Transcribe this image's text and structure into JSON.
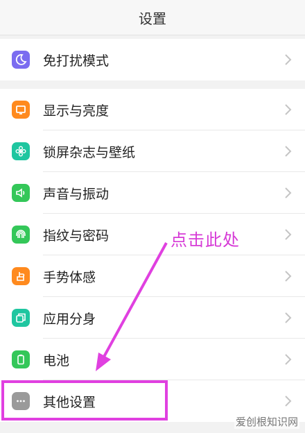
{
  "header": {
    "title": "设置"
  },
  "group1": [
    {
      "label": "免打扰模式",
      "icon": "moon-icon",
      "color": "#7b6cf0"
    }
  ],
  "group2": [
    {
      "label": "显示与亮度",
      "icon": "display-icon",
      "color": "#ff8a1e"
    },
    {
      "label": "锁屏杂志与壁纸",
      "icon": "flower-icon",
      "color": "#1fc6a0"
    },
    {
      "label": "声音与振动",
      "icon": "speaker-icon",
      "color": "#34c759"
    },
    {
      "label": "指纹与密码",
      "icon": "fingerprint-icon",
      "color": "#34c759"
    },
    {
      "label": "手势体感",
      "icon": "hand-icon",
      "color": "#ff8a1e"
    },
    {
      "label": "应用分身",
      "icon": "clone-icon",
      "color": "#1fc6a0"
    },
    {
      "label": "电池",
      "icon": "battery-icon",
      "color": "#34c759"
    },
    {
      "label": "其他设置",
      "icon": "more-icon",
      "color": "#9a9a9a"
    }
  ],
  "annotation": {
    "text": "点击此处",
    "color": "#e040e0"
  },
  "watermark": {
    "text": "爱创根知识网"
  }
}
